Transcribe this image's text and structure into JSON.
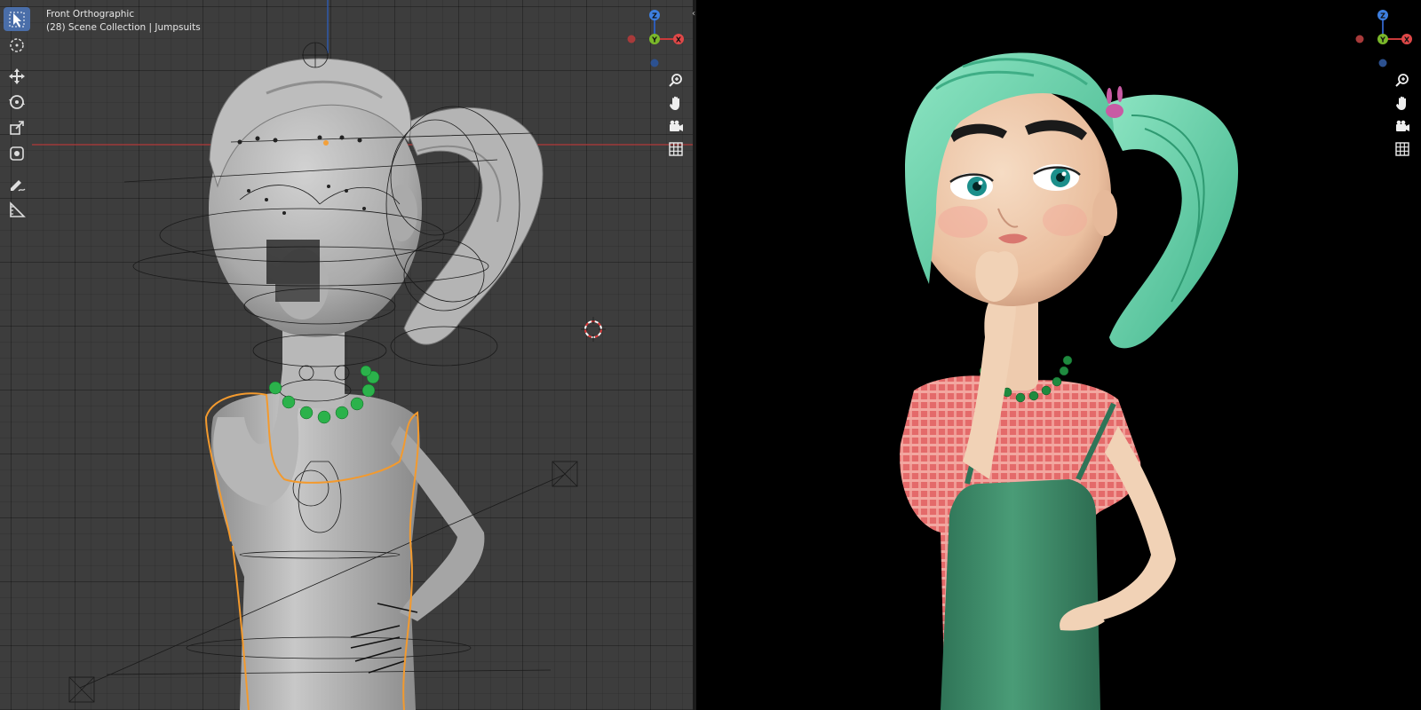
{
  "viewport_left": {
    "view_name": "Front Orthographic",
    "collection_info": "(28) Scene Collection | Jumpsuits",
    "grid_color": "#3d3d3d",
    "x_axis_color": "#b33a3a",
    "z_axis_color": "#2e5bb5",
    "selection_outline_color": "#f39a2e",
    "tools": [
      {
        "name": "select-box",
        "icon": "cursor-arrow-icon",
        "active": true
      },
      {
        "name": "cursor",
        "icon": "3d-cursor-icon"
      },
      {
        "name": "move",
        "icon": "move-arrows-icon"
      },
      {
        "name": "rotate",
        "icon": "rotate-icon"
      },
      {
        "name": "scale",
        "icon": "scale-icon"
      },
      {
        "name": "transform",
        "icon": "transform-icon"
      },
      {
        "name": "annotate",
        "icon": "pencil-icon"
      },
      {
        "name": "measure",
        "icon": "ruler-icon"
      }
    ],
    "gizmo": {
      "z": "Z",
      "y": "Y",
      "x": "X"
    },
    "nav": [
      "zoom-icon",
      "hand-icon",
      "camera-icon",
      "grid-icon"
    ]
  },
  "viewport_right": {
    "render_background": "#000000",
    "gizmo": {
      "z": "Z",
      "y": "Y",
      "x": "X"
    },
    "nav": [
      "zoom-icon",
      "hand-icon",
      "camera-icon",
      "grid-icon"
    ],
    "hair_color": "#6fd1ab",
    "shirt_color": "#e06a6a",
    "overall_color": "#3f8f6c"
  }
}
